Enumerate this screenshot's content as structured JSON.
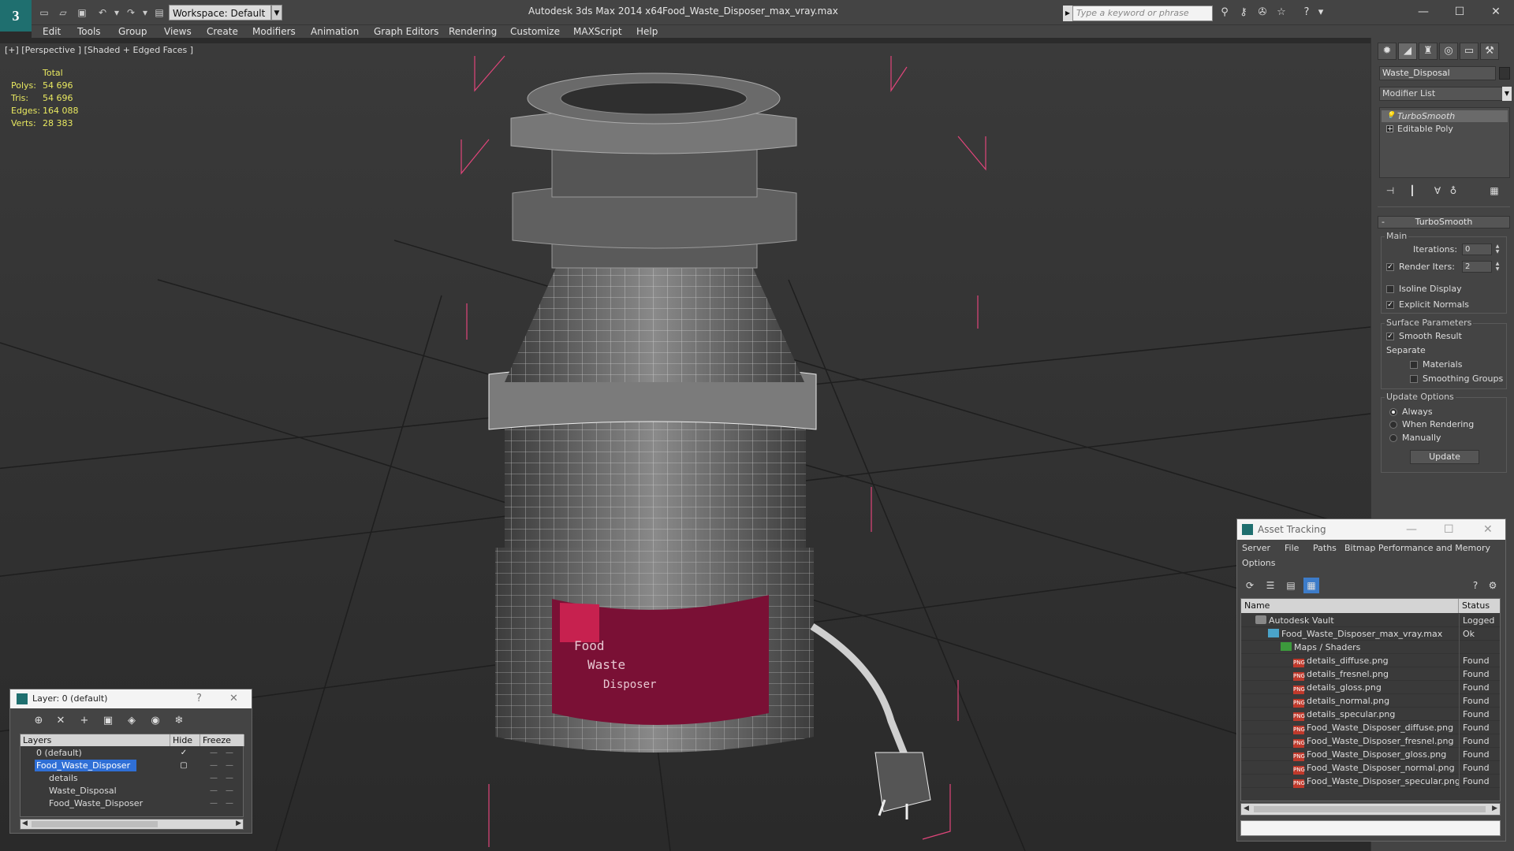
{
  "titlebar": {
    "app_title": "Autodesk 3ds Max  2014 x64",
    "file_title": "Food_Waste_Disposer_max_vray.max",
    "workspace": "Workspace: Default",
    "search_placeholder": "Type a keyword or phrase"
  },
  "menu": [
    "Edit",
    "Tools",
    "Group",
    "Views",
    "Create",
    "Modifiers",
    "Animation",
    "Graph Editors",
    "Rendering",
    "Customize",
    "MAXScript",
    "Help"
  ],
  "viewport": {
    "label": "[+] [Perspective ] [Shaded + Edged Faces ]",
    "stats_header": "Total",
    "stats": [
      {
        "label": "Polys:",
        "value": "54 696"
      },
      {
        "label": "Tris:",
        "value": "54 696"
      },
      {
        "label": "Edges:",
        "value": "164 088"
      },
      {
        "label": "Verts:",
        "value": "28 383"
      }
    ],
    "label_lines": [
      "Food",
      "Waste",
      "Disposer"
    ]
  },
  "command_panel": {
    "object_name": "Waste_Disposal",
    "modifier_list": "Modifier List",
    "stack": [
      "TurboSmooth",
      "Editable Poly"
    ],
    "rollout_title": "TurboSmooth",
    "main_group": "Main",
    "iterations_label": "Iterations:",
    "iterations_value": "0",
    "render_iters_label": "Render Iters:",
    "render_iters_value": "2",
    "isoline_label": "Isoline Display",
    "explicit_label": "Explicit Normals",
    "surface_group": "Surface Parameters",
    "smooth_label": "Smooth Result",
    "separate_label": "Separate",
    "materials_label": "Materials",
    "smoothing_label": "Smoothing Groups",
    "update_group": "Update Options",
    "always_label": "Always",
    "when_rendering_label": "When Rendering",
    "manually_label": "Manually",
    "update_button": "Update"
  },
  "layer_window": {
    "title": "Layer: 0 (default)",
    "help": "?",
    "col_layers": "Layers",
    "col_hide": "Hide",
    "col_freeze": "Freeze",
    "rows": [
      {
        "name": "0 (default)",
        "indent": 0,
        "selected": false
      },
      {
        "name": "Food_Waste_Disposer",
        "indent": 0,
        "selected": true
      },
      {
        "name": "details",
        "indent": 1,
        "selected": false
      },
      {
        "name": "Waste_Disposal",
        "indent": 1,
        "selected": false
      },
      {
        "name": "Food_Waste_Disposer",
        "indent": 1,
        "selected": false
      }
    ]
  },
  "asset_window": {
    "title": "Asset Tracking",
    "menu": [
      "Server",
      "File",
      "Paths",
      "Bitmap Performance and Memory",
      "Options"
    ],
    "col_name": "Name",
    "col_status": "Status",
    "rows": [
      {
        "name": "Autodesk Vault",
        "status": "Logged",
        "icon": "vault",
        "indent": 0
      },
      {
        "name": "Food_Waste_Disposer_max_vray.max",
        "status": "Ok",
        "icon": "max",
        "indent": 1
      },
      {
        "name": "Maps / Shaders",
        "status": "",
        "icon": "folder",
        "indent": 2
      },
      {
        "name": "details_diffuse.png",
        "status": "Found",
        "icon": "png",
        "indent": 3
      },
      {
        "name": "details_fresnel.png",
        "status": "Found",
        "icon": "png",
        "indent": 3
      },
      {
        "name": "details_gloss.png",
        "status": "Found",
        "icon": "png",
        "indent": 3
      },
      {
        "name": "details_normal.png",
        "status": "Found",
        "icon": "png",
        "indent": 3
      },
      {
        "name": "details_specular.png",
        "status": "Found",
        "icon": "png",
        "indent": 3
      },
      {
        "name": "Food_Waste_Disposer_diffuse.png",
        "status": "Found",
        "icon": "png",
        "indent": 3
      },
      {
        "name": "Food_Waste_Disposer_fresnel.png",
        "status": "Found",
        "icon": "png",
        "indent": 3
      },
      {
        "name": "Food_Waste_Disposer_gloss.png",
        "status": "Found",
        "icon": "png",
        "indent": 3
      },
      {
        "name": "Food_Waste_Disposer_normal.png",
        "status": "Found",
        "icon": "png",
        "indent": 3
      },
      {
        "name": "Food_Waste_Disposer_specular.png",
        "status": "Found",
        "icon": "png",
        "indent": 3
      }
    ]
  }
}
